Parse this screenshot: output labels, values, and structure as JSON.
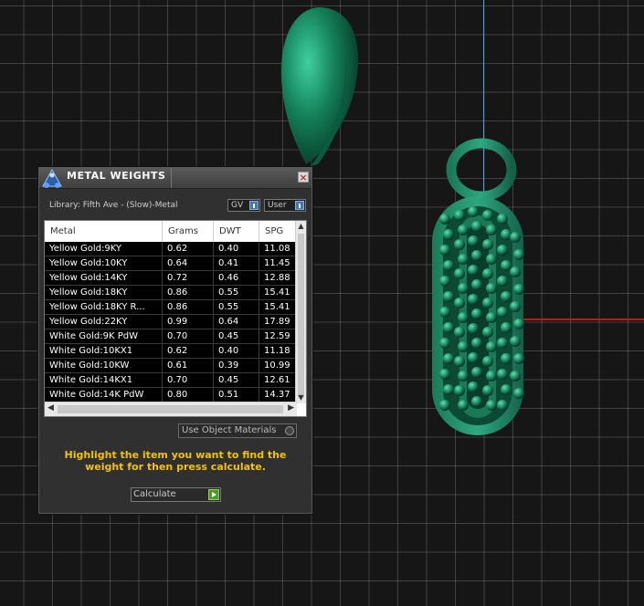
{
  "dialog": {
    "title": "METAL WEIGHTS",
    "close_symbol": "×",
    "library_label": "Library: Fifth Ave - (Slow)-Metal",
    "gv_label": "GV",
    "user_label": "User",
    "use_object_materials_label": "Use Object Materials",
    "instruction": "Highlight the item you want to find the weight for then press calculate.",
    "calculate_label": "Calculate"
  },
  "table": {
    "columns": [
      "Metal",
      "Grams",
      "DWT",
      "SPG"
    ],
    "rows": [
      {
        "metal": "Yellow Gold:9KY",
        "grams": "0.62",
        "dwt": "0.40",
        "spg": "11.08"
      },
      {
        "metal": "Yellow Gold:10KY",
        "grams": "0.64",
        "dwt": "0.41",
        "spg": "11.45"
      },
      {
        "metal": "Yellow Gold:14KY",
        "grams": "0.72",
        "dwt": "0.46",
        "spg": "12.88"
      },
      {
        "metal": "Yellow Gold:18KY",
        "grams": "0.86",
        "dwt": "0.55",
        "spg": "15.41"
      },
      {
        "metal": "Yellow Gold:18KY R...",
        "grams": "0.86",
        "dwt": "0.55",
        "spg": "15.41"
      },
      {
        "metal": "Yellow Gold:22KY",
        "grams": "0.99",
        "dwt": "0.64",
        "spg": "17.89"
      },
      {
        "metal": "White Gold:9K PdW",
        "grams": "0.70",
        "dwt": "0.45",
        "spg": "12.59"
      },
      {
        "metal": "White Gold:10KX1",
        "grams": "0.62",
        "dwt": "0.40",
        "spg": "11.18"
      },
      {
        "metal": "White Gold:10KW",
        "grams": "0.61",
        "dwt": "0.39",
        "spg": "10.99"
      },
      {
        "metal": "White Gold:14KX1",
        "grams": "0.70",
        "dwt": "0.45",
        "spg": "12.61"
      },
      {
        "metal": "White Gold:14K PdW",
        "grams": "0.80",
        "dwt": "0.51",
        "spg": "14.37"
      }
    ]
  },
  "colors": {
    "grid_background": "#161616",
    "jewelry_green": "#1f8a66",
    "instruction_yellow": "#f2c20c",
    "axis_blue": "#2ea6e6",
    "axis_red": "#c41818"
  }
}
